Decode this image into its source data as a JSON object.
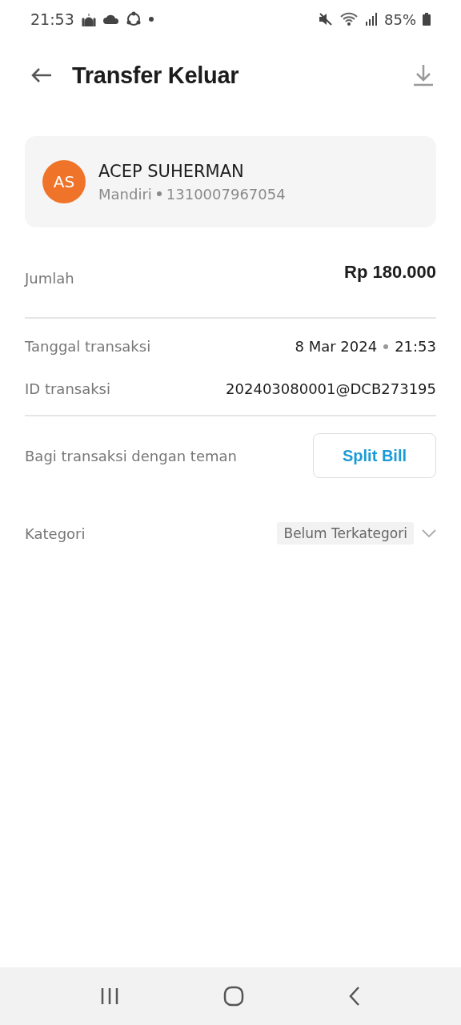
{
  "status_bar": {
    "time": "21:53",
    "battery": "85%"
  },
  "header": {
    "title": "Transfer Keluar"
  },
  "recipient": {
    "initials": "AS",
    "name": "ACEP SUHERMAN",
    "bank": "Mandiri",
    "account": "1310007967054"
  },
  "amount": {
    "label": "Jumlah",
    "value": "Rp 180.000"
  },
  "details": [
    {
      "label": "Tanggal transaksi",
      "value": "8 Mar 2024",
      "extra": "21:53"
    },
    {
      "label": "ID transaksi",
      "value": "202403080001@DCB273195"
    }
  ],
  "split": {
    "label": "Bagi transaksi dengan teman",
    "button": "Split Bill"
  },
  "category": {
    "label": "Kategori",
    "value": "Belum Terkategori"
  }
}
